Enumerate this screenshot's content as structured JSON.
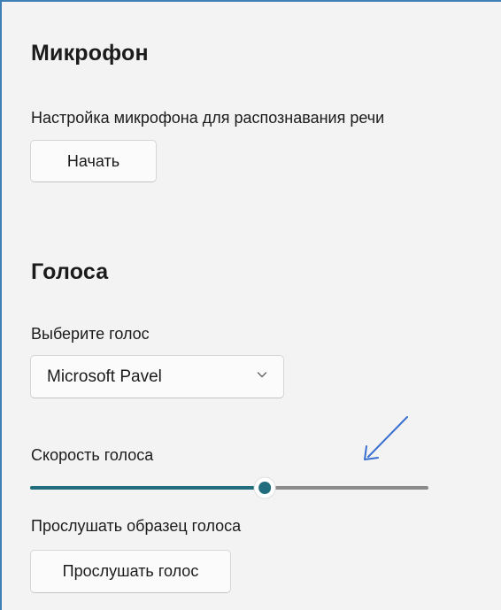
{
  "microphone": {
    "title": "Микрофон",
    "description": "Настройка микрофона для распознавания речи",
    "start_button_label": "Начать"
  },
  "voices": {
    "title": "Голоса",
    "select_label": "Выберите голос",
    "selected_voice": "Microsoft Pavel",
    "speed_label": "Скорость голоса",
    "speed_value_fraction": 0.59,
    "sample_label": "Прослушать образец голоса",
    "listen_button_label": "Прослушать голос"
  },
  "colors": {
    "accent": "#216d7e",
    "track_inactive": "#8a8a8a",
    "annotation_arrow": "#3a6fd0"
  },
  "icons": {
    "dropdown": "chevron-down-icon",
    "annotation": "arrow-pointer-icon"
  }
}
